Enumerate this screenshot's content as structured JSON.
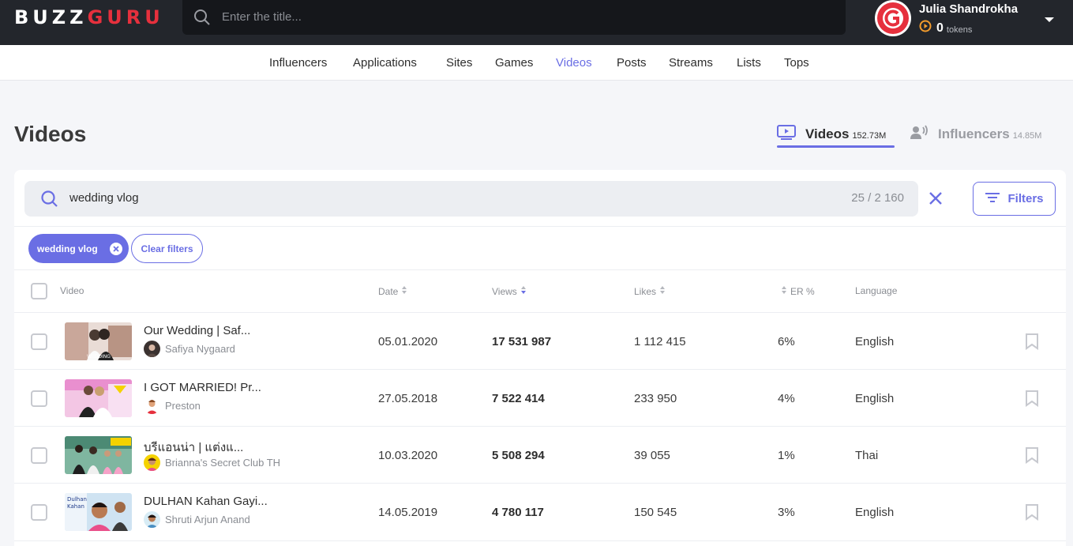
{
  "header": {
    "logo_left": "BUZZ",
    "logo_right": "GURU",
    "search_placeholder": "Enter the title...",
    "user_name": "Julia Shandrokha",
    "tokens_count": "0",
    "tokens_label": "tokens"
  },
  "nav": {
    "items": [
      "Influencers",
      "Applications",
      "Sites",
      "Games",
      "Videos",
      "Posts",
      "Streams",
      "Lists",
      "Tops"
    ],
    "active": "Videos"
  },
  "page": {
    "title": "Videos",
    "tabs": [
      {
        "label": "Videos",
        "count": "152.73M"
      },
      {
        "label": "Influencers",
        "count": "14.85M"
      }
    ]
  },
  "search": {
    "query": "wedding vlog",
    "results": "25 / 2 160",
    "filters_label": "Filters"
  },
  "chips": {
    "active_filter": "wedding vlog",
    "clear_label": "Clear filters"
  },
  "table": {
    "columns": {
      "video": "Video",
      "date": "Date",
      "views": "Views",
      "likes": "Likes",
      "er": "ER %",
      "language": "Language"
    },
    "rows": [
      {
        "title": "Our Wedding | Saf...",
        "channel": "Safiya Nygaard",
        "date": "05.01.2020",
        "views": "17 531 987",
        "likes": "1 112 415",
        "er": "6%",
        "language": "English"
      },
      {
        "title": "I GOT MARRIED! Pr...",
        "channel": "Preston",
        "date": "27.05.2018",
        "views": "7 522 414",
        "likes": "233 950",
        "er": "4%",
        "language": "English"
      },
      {
        "title": "บรีแอนน่า | แต่งแ...",
        "channel": "Brianna's Secret Club TH",
        "date": "10.03.2020",
        "views": "5 508 294",
        "likes": "39 055",
        "er": "1%",
        "language": "Thai"
      },
      {
        "title": "DULHAN Kahan Gayi...",
        "channel": "Shruti Arjun Anand",
        "date": "14.05.2019",
        "views": "4 780 117",
        "likes": "150 545",
        "er": "3%",
        "language": "English"
      }
    ]
  },
  "colors": {
    "accent": "#6a6ee4",
    "brand_red": "#e6303d",
    "topbar": "#23262c"
  }
}
